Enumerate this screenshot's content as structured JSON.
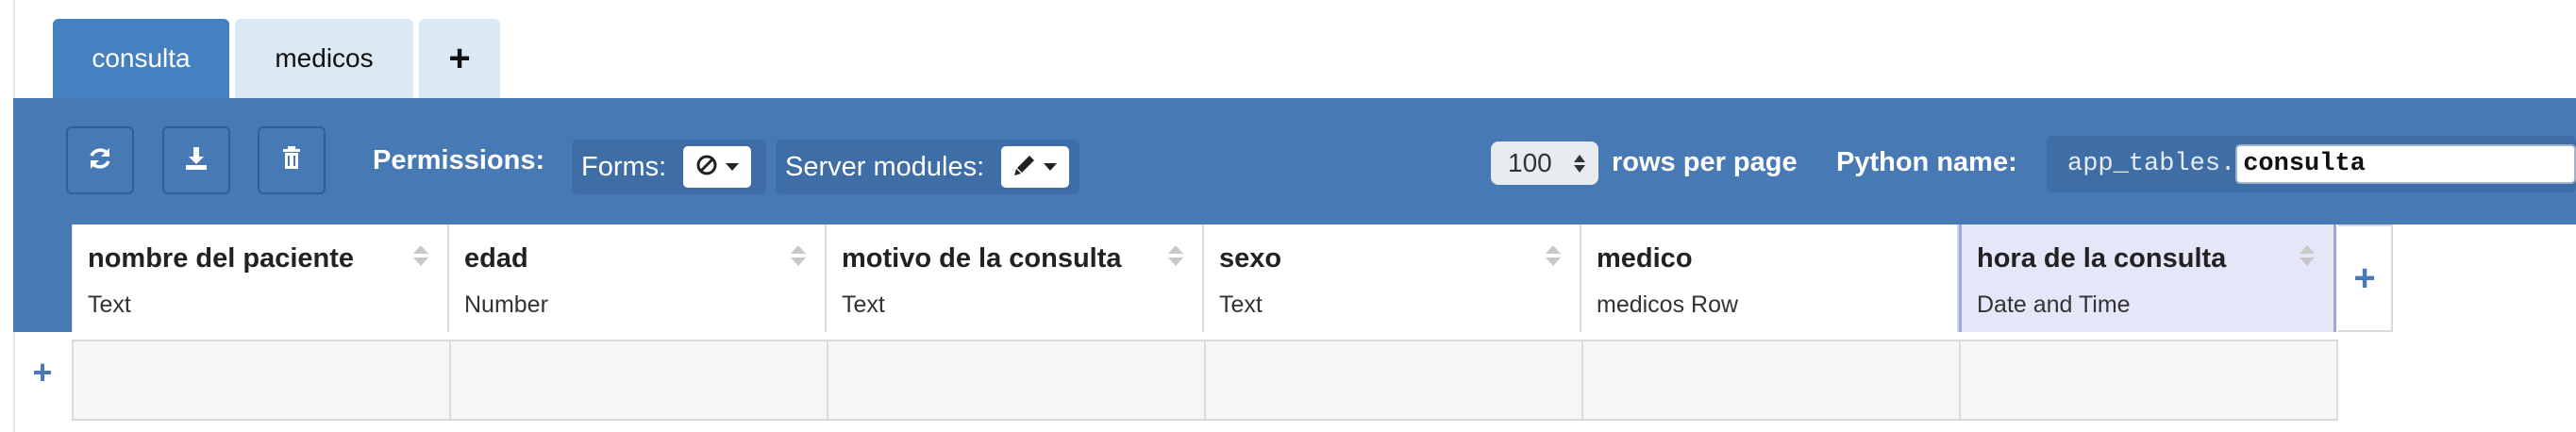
{
  "tabs": [
    {
      "label": "consulta",
      "active": true
    },
    {
      "label": "medicos",
      "active": false
    },
    {
      "label": "+",
      "active": false
    }
  ],
  "toolbar": {
    "refresh_icon": "refresh-icon",
    "download_icon": "download-icon",
    "delete_icon": "trash-icon",
    "permissions_label": "Permissions:",
    "forms_label": "Forms:",
    "forms_icon": "no-access-icon",
    "server_modules_label": "Server modules:",
    "server_modules_icon": "pencil-icon",
    "rows_per_page_value": "100",
    "rows_per_page_label": "rows per page",
    "python_name_label": "Python name:",
    "python_prefix": "app_tables.",
    "python_name_value": "consulta"
  },
  "columns": [
    {
      "name": "nombre del paciente",
      "type": "Text"
    },
    {
      "name": "edad",
      "type": "Number"
    },
    {
      "name": "motivo de la consulta",
      "type": "Text"
    },
    {
      "name": "sexo",
      "type": "Text"
    },
    {
      "name": "medico",
      "type": "medicos Row"
    },
    {
      "name": "hora de la consulta",
      "type": "Date and Time"
    }
  ],
  "add_column_label": "+",
  "add_row_label": "+",
  "colors": {
    "accent": "#4779b5",
    "tab_active": "#4580c0",
    "tab_inactive": "#dbe9f5",
    "highlight_column": "#e5e6f8"
  }
}
